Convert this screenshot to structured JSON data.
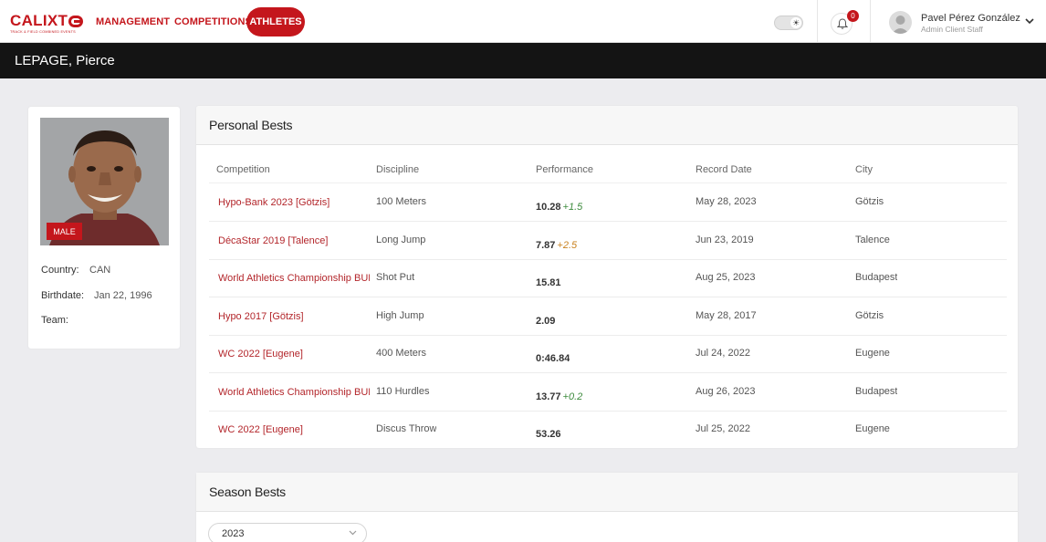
{
  "brand": {
    "name_part1": "CALIXT",
    "name_part2": "",
    "tagline": "TRACK & FIELD COMBINED EVENTS"
  },
  "nav": {
    "items": [
      {
        "label": "MANAGEMENT"
      },
      {
        "label": "COMPETITIONS"
      },
      {
        "label": "ATHLETES",
        "active": true
      }
    ]
  },
  "header": {
    "theme_toggle_icon": "☀",
    "notifications_count": "0",
    "user_name": "Pavel Pérez González",
    "user_role": "Admin Client Staff"
  },
  "page": {
    "title": "LEPAGE, Pierce"
  },
  "athlete": {
    "gender": "MALE",
    "country_label": "Country:",
    "country": "CAN",
    "birthdate_label": "Birthdate:",
    "birthdate": "Jan 22, 1996",
    "team_label": "Team:",
    "team": ""
  },
  "personal_bests": {
    "title": "Personal Bests",
    "columns": [
      "Competition",
      "Discipline",
      "Performance",
      "Record Date",
      "City"
    ],
    "rows": [
      {
        "competition": "Hypo-Bank 2023 [Götzis]",
        "discipline": "100 Meters",
        "performance": "10.28",
        "wind": "+1.5",
        "wind_color": "#3d8b3d",
        "date": "May 28, 2023",
        "city": "Götzis"
      },
      {
        "competition": "DécaStar 2019 [Talence]",
        "discipline": "Long Jump",
        "performance": "7.87",
        "wind": "+2.5",
        "wind_color": "#c9821e",
        "date": "Jun 23, 2019",
        "city": "Talence"
      },
      {
        "competition": "World Athletics Championship BUD",
        "discipline": "Shot Put",
        "performance": "15.81",
        "wind": "",
        "wind_color": "#3d8b3d",
        "date": "Aug 25, 2023",
        "city": "Budapest"
      },
      {
        "competition": "Hypo 2017 [Götzis]",
        "discipline": "High Jump",
        "performance": "2.09",
        "wind": "",
        "wind_color": "#3d8b3d",
        "date": "May 28, 2017",
        "city": "Götzis"
      },
      {
        "competition": "WC 2022 [Eugene]",
        "discipline": "400 Meters",
        "performance": "0:46.84",
        "wind": "",
        "wind_color": "#3d8b3d",
        "date": "Jul 24, 2022",
        "city": "Eugene"
      },
      {
        "competition": "World Athletics Championship BUD",
        "discipline": "110 Hurdles",
        "performance": "13.77",
        "wind": "+0.2",
        "wind_color": "#3d8b3d",
        "date": "Aug 26, 2023",
        "city": "Budapest"
      },
      {
        "competition": "WC 2022 [Eugene]",
        "discipline": "Discus Throw",
        "performance": "53.26",
        "wind": "",
        "wind_color": "#3d8b3d",
        "date": "Jul 25, 2022",
        "city": "Eugene"
      }
    ]
  },
  "season_bests": {
    "title": "Season Bests",
    "selected_year": "2023"
  },
  "colors": {
    "accent": "#c4161c",
    "title_bar": "#141414",
    "page_bg": "#ececef"
  }
}
